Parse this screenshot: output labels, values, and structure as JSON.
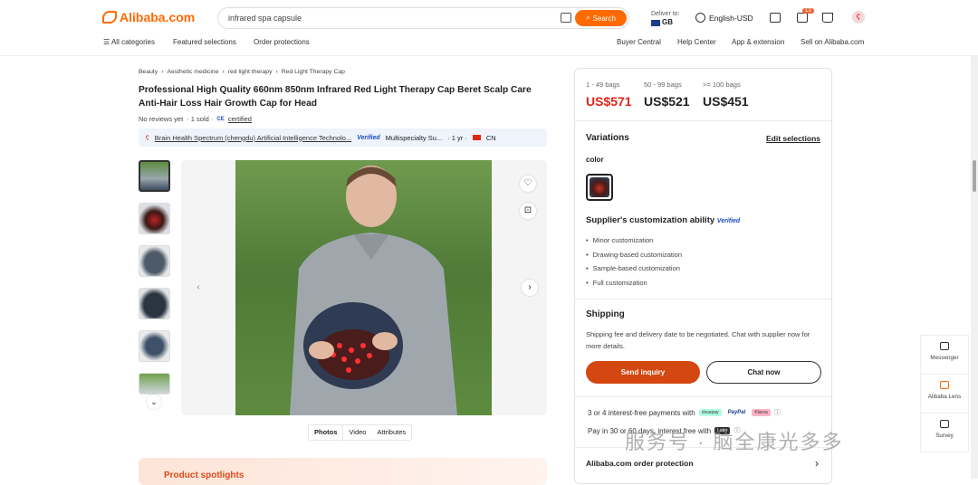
{
  "header": {
    "logo_text": "Alibaba.com",
    "search_placeholder": "infrared spa capsule",
    "search_button": "Search",
    "deliver_label": "Deliver to:",
    "deliver_country": "GB",
    "language": "English-USD",
    "cart_badge": "13"
  },
  "nav": {
    "all_categories": "All categories",
    "featured": "Featured selections",
    "order_protections": "Order protections",
    "buyer_central": "Buyer Central",
    "help_center": "Help Center",
    "app_extension": "App & extension",
    "sell": "Sell on Alibaba.com"
  },
  "breadcrumb": [
    "Beauty",
    "Aesthetic medicine",
    "red light therapy",
    "Red Light Therapy Cap"
  ],
  "product": {
    "title": "Professional High Quality 660nm 850nm Infrared Red Light Therapy Cap Beret Scalp Care Anti-Hair Loss Hair Growth Cap for Head",
    "reviews": "No reviews yet",
    "sold": "· 1 sold ·",
    "ce_badge": "CE",
    "certified": "certified"
  },
  "supplier": {
    "name": "Brain Health Spectrum (chengdu) Artificial Intelligence Technolo...",
    "verified": "Verified",
    "type": "Multispecialty Su...",
    "years": "· 1 yr ·",
    "country": "CN"
  },
  "media_tabs": [
    "Photos",
    "Video",
    "Attributes"
  ],
  "spotlights": "Product spotlights",
  "pricing": {
    "tiers": [
      {
        "range": "1 - 49 bags",
        "price": "US$571"
      },
      {
        "range": "50 - 99 bags",
        "price": "US$521"
      },
      {
        "range": ">= 100 bags",
        "price": "US$451"
      }
    ]
  },
  "variations": {
    "title": "Variations",
    "edit": "Edit selections",
    "color_label": "color"
  },
  "customization": {
    "title": "Supplier's customization ability",
    "verified": "Verified",
    "items": [
      "Minor customization",
      "Drawing-based customization",
      "Sample-based customization",
      "Full customization"
    ]
  },
  "shipping": {
    "title": "Shipping",
    "text": "Shipping fee and delivery date to be negotiated. Chat with supplier now for more details."
  },
  "actions": {
    "send_inquiry": "Send inquiry",
    "chat_now": "Chat now"
  },
  "payments": {
    "installments": "3 or 4 interest-free payments with",
    "chip1": "clearpay",
    "chip2": "PayPal",
    "chip3": "Klarna",
    "pay_later": "Pay in 30 or 60 days, interest free with",
    "chip4": "Later"
  },
  "order_protection": "Alibaba.com order protection",
  "side_tools": {
    "messenger": "Messenger",
    "lens": "Alibaba Lens",
    "survey": "Survey"
  },
  "watermark": "服务号 · 脑全康光多多",
  "colors": {
    "brand": "#ff6a00",
    "price_red": "#e1251b",
    "inquiry": "#d44710"
  }
}
